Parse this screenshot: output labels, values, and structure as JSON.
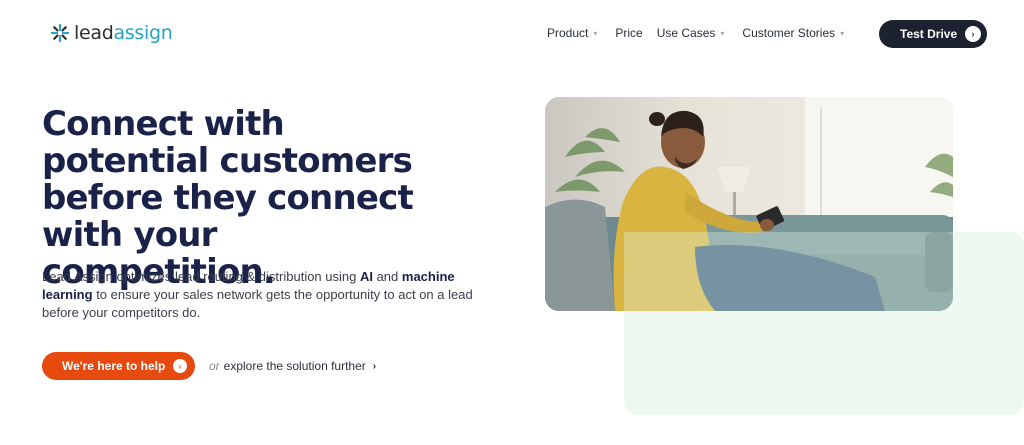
{
  "brand": {
    "logo_part1": "lead",
    "logo_part2": "assign",
    "accent_color": "#26a3c6"
  },
  "nav": {
    "items": [
      {
        "label": "Product",
        "has_dropdown": true
      },
      {
        "label": "Price",
        "has_dropdown": false
      },
      {
        "label": "Use Cases",
        "has_dropdown": true
      },
      {
        "label": "Customer Stories",
        "has_dropdown": true
      }
    ],
    "cta_label": "Test Drive",
    "cta_color": "#1c2230"
  },
  "hero": {
    "title": "Connect with potential customers before they connect with your competition.",
    "desc_1": "Lead Assign optimizes lead routing & distribution using ",
    "desc_bold_1": "AI",
    "desc_2": " and ",
    "desc_bold_2": "machine learning",
    "desc_3": " to ensure your sales network gets the opportunity to act on a lead before your competitors do.",
    "primary_button": "We're here to help",
    "primary_color": "#e64a0f",
    "secondary_prefix": "or",
    "secondary_link": "explore the solution further"
  },
  "media": {
    "photo_icon": "photo-man-on-sofa-with-tablet",
    "panel_color": "#eef9f1"
  }
}
